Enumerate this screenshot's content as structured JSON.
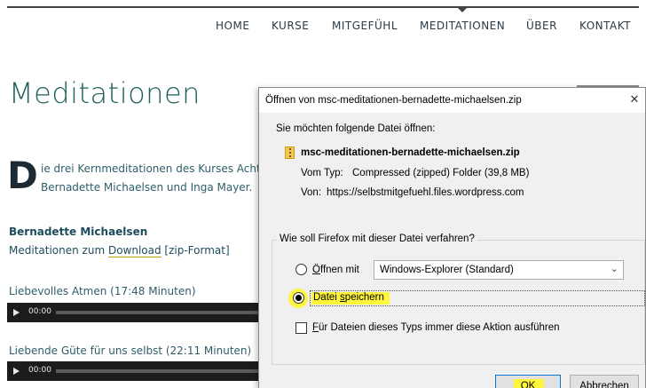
{
  "site": {
    "nav": [
      "HOME",
      "KURSE",
      "MITGEFÜHL",
      "MEDITATIONEN",
      "ÜBER",
      "KONTAKT"
    ],
    "page_title": "Meditationen",
    "intro_dropcap": "D",
    "intro_line1": "ie drei Kernmeditationen des Kurses Acht",
    "intro_line2": "Bernadette Michaelsen und Inga Mayer.",
    "author": "Bernadette Michaelsen",
    "download_prefix": "Meditationen zum ",
    "download_link": "Download",
    "download_suffix": " [zip-Format]",
    "tracks": [
      {
        "title": "Liebevolles Atmen (17:48 Minuten)",
        "time": "00:00"
      },
      {
        "title": "Liebende Güte für uns selbst (22:11 Minuten)",
        "time": "00:00"
      }
    ]
  },
  "dialog": {
    "title": "Öffnen von msc-meditationen-bernadette-michaelsen.zip",
    "close_icon": "close-icon",
    "prompt": "Sie möchten folgende Datei öffnen:",
    "file_icon": "zip-file-icon",
    "filename": "msc-meditationen-bernadette-michaelsen.zip",
    "type_label": "Vom Typ:",
    "type_value": "Compressed (zipped) Folder (39,8 MB)",
    "from_label": "Von:",
    "from_value": "https://selbstmitgefuehl.files.wordpress.com",
    "question": "Wie soll Firefox mit dieser Datei verfahren?",
    "open_with_label_u": "Ö",
    "open_with_label_rest": "ffnen mit",
    "open_with_app": "Windows-Explorer (Standard)",
    "save_label_pre": "Datei ",
    "save_label_u": "s",
    "save_label_rest": "peichern",
    "always_u": "F",
    "always_rest": "ür Dateien dieses Typs immer diese Aktion ausführen",
    "ok": "OK",
    "cancel": "Abbrechen",
    "selected_option": "save",
    "highlight_color": "#fff53a"
  }
}
